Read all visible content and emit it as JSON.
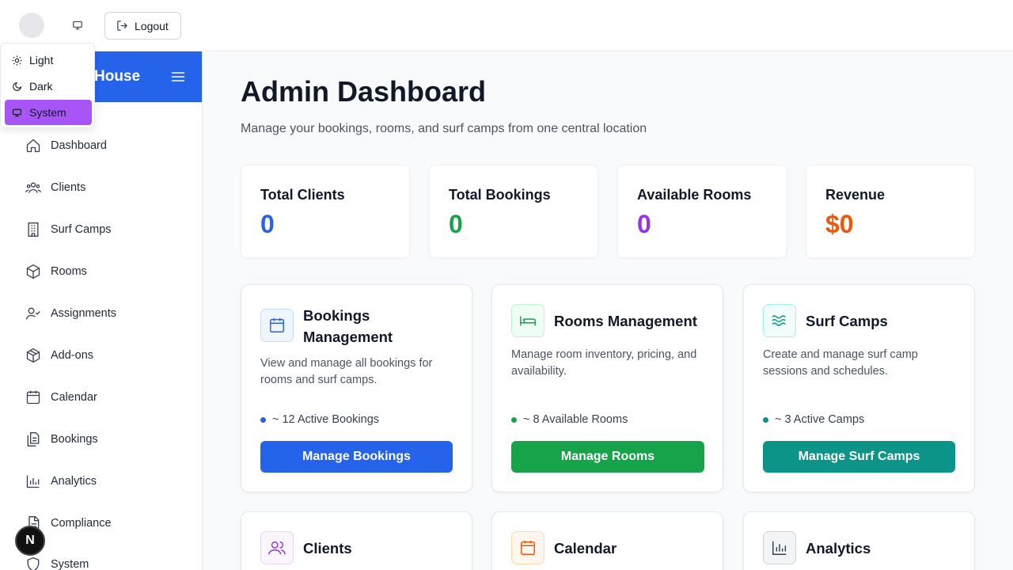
{
  "topbar": {
    "logout_label": "Logout"
  },
  "theme_menu": {
    "items": [
      {
        "label": "Light",
        "icon": "sun-icon"
      },
      {
        "label": "Dark",
        "icon": "moon-icon"
      },
      {
        "label": "System",
        "icon": "monitor-icon",
        "selected": true
      }
    ]
  },
  "sidebar": {
    "brand": "House",
    "items": [
      {
        "label": "Dashboard",
        "icon": "home-icon"
      },
      {
        "label": "Clients",
        "icon": "users-icon"
      },
      {
        "label": "Surf Camps",
        "icon": "building-icon"
      },
      {
        "label": "Rooms",
        "icon": "box-icon"
      },
      {
        "label": "Assignments",
        "icon": "user-check-icon"
      },
      {
        "label": "Add-ons",
        "icon": "package-icon"
      },
      {
        "label": "Calendar",
        "icon": "calendar-icon"
      },
      {
        "label": "Bookings",
        "icon": "files-icon"
      },
      {
        "label": "Analytics",
        "icon": "bar-chart-icon"
      },
      {
        "label": "Compliance",
        "icon": "file-text-icon"
      },
      {
        "label": "System",
        "icon": "shield-icon"
      }
    ]
  },
  "main": {
    "title": "Admin Dashboard",
    "subtitle": "Manage your bookings, rooms, and surf camps from one central location",
    "stats": [
      {
        "label": "Total Clients",
        "value": "0",
        "color": "#2563eb"
      },
      {
        "label": "Total Bookings",
        "value": "0",
        "color": "#16a34a"
      },
      {
        "label": "Available Rooms",
        "value": "0",
        "color": "#9333ea"
      },
      {
        "label": "Revenue",
        "value": "$0",
        "color": "#ea580c"
      }
    ],
    "cards": [
      {
        "title": "Bookings Management",
        "description": "View and manage all bookings for rooms and surf camps.",
        "stat": "~ 12 Active Bookings",
        "button": "Manage Bookings",
        "color": "#2563eb"
      },
      {
        "title": "Rooms Management",
        "description": "Manage room inventory, pricing, and availability.",
        "stat": "~ 8 Available Rooms",
        "button": "Manage Rooms",
        "color": "#16a34a"
      },
      {
        "title": "Surf Camps",
        "description": "Create and manage surf camp sessions and schedules.",
        "stat": "~ 3 Active Camps",
        "button": "Manage Surf Camps",
        "color": "#0d9488"
      },
      {
        "title": "Clients"
      },
      {
        "title": "Calendar"
      },
      {
        "title": "Analytics"
      }
    ]
  },
  "badge": "N"
}
